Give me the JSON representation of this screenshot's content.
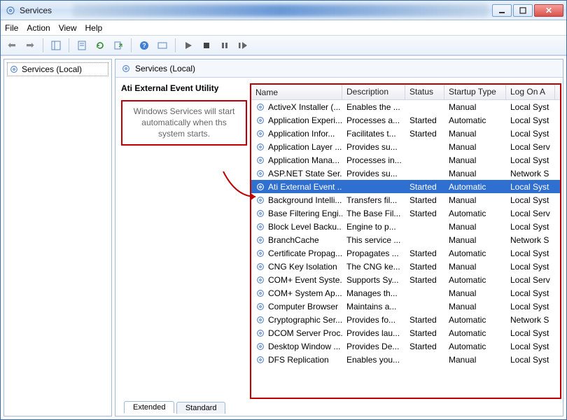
{
  "window": {
    "title": "Services"
  },
  "menu": {
    "file": "File",
    "action": "Action",
    "view": "View",
    "help": "Help"
  },
  "tree": {
    "root": "Services (Local)"
  },
  "header": {
    "title": "Services (Local)"
  },
  "detail": {
    "selected_name": "Ati External Event Utility",
    "annotation": "Windows Services will start automatically when ths system starts."
  },
  "columns": {
    "name": "Name",
    "description": "Description",
    "status": "Status",
    "startup": "Startup Type",
    "logon": "Log On A"
  },
  "tabs": {
    "extended": "Extended",
    "standard": "Standard"
  },
  "services": [
    {
      "name": "ActiveX Installer (...",
      "desc": "Enables the ...",
      "status": "",
      "startup": "Manual",
      "logon": "Local Syst"
    },
    {
      "name": "Application Experi...",
      "desc": "Processes a...",
      "status": "Started",
      "startup": "Automatic",
      "logon": "Local Syst"
    },
    {
      "name": "Application Infor...",
      "desc": "Facilitates t...",
      "status": "Started",
      "startup": "Manual",
      "logon": "Local Syst"
    },
    {
      "name": "Application Layer ...",
      "desc": "Provides su...",
      "status": "",
      "startup": "Manual",
      "logon": "Local Serv"
    },
    {
      "name": "Application Mana...",
      "desc": "Processes in...",
      "status": "",
      "startup": "Manual",
      "logon": "Local Syst"
    },
    {
      "name": "ASP.NET State Ser...",
      "desc": "Provides su...",
      "status": "",
      "startup": "Manual",
      "logon": "Network S"
    },
    {
      "name": "Ati External Event ...",
      "desc": "",
      "status": "Started",
      "startup": "Automatic",
      "logon": "Local Syst",
      "selected": true
    },
    {
      "name": "Background Intelli...",
      "desc": "Transfers fil...",
      "status": "Started",
      "startup": "Manual",
      "logon": "Local Syst"
    },
    {
      "name": "Base Filtering Engi...",
      "desc": "The Base Fil...",
      "status": "Started",
      "startup": "Automatic",
      "logon": "Local Serv"
    },
    {
      "name": "Block Level Backu...",
      "desc": "Engine to p...",
      "status": "",
      "startup": "Manual",
      "logon": "Local Syst"
    },
    {
      "name": "BranchCache",
      "desc": "This service ...",
      "status": "",
      "startup": "Manual",
      "logon": "Network S"
    },
    {
      "name": "Certificate Propag...",
      "desc": "Propagates ...",
      "status": "Started",
      "startup": "Automatic",
      "logon": "Local Syst"
    },
    {
      "name": "CNG Key Isolation",
      "desc": "The CNG ke...",
      "status": "Started",
      "startup": "Manual",
      "logon": "Local Syst"
    },
    {
      "name": "COM+ Event Syste...",
      "desc": "Supports Sy...",
      "status": "Started",
      "startup": "Automatic",
      "logon": "Local Serv"
    },
    {
      "name": "COM+ System Ap...",
      "desc": "Manages th...",
      "status": "",
      "startup": "Manual",
      "logon": "Local Syst"
    },
    {
      "name": "Computer Browser",
      "desc": "Maintains a...",
      "status": "",
      "startup": "Manual",
      "logon": "Local Syst"
    },
    {
      "name": "Cryptographic Ser...",
      "desc": "Provides fo...",
      "status": "Started",
      "startup": "Automatic",
      "logon": "Network S"
    },
    {
      "name": "DCOM Server Proc...",
      "desc": "Provides lau...",
      "status": "Started",
      "startup": "Automatic",
      "logon": "Local Syst"
    },
    {
      "name": "Desktop Window ...",
      "desc": "Provides De...",
      "status": "Started",
      "startup": "Automatic",
      "logon": "Local Syst"
    },
    {
      "name": "DFS Replication",
      "desc": "Enables you...",
      "status": "",
      "startup": "Manual",
      "logon": "Local Syst"
    }
  ]
}
